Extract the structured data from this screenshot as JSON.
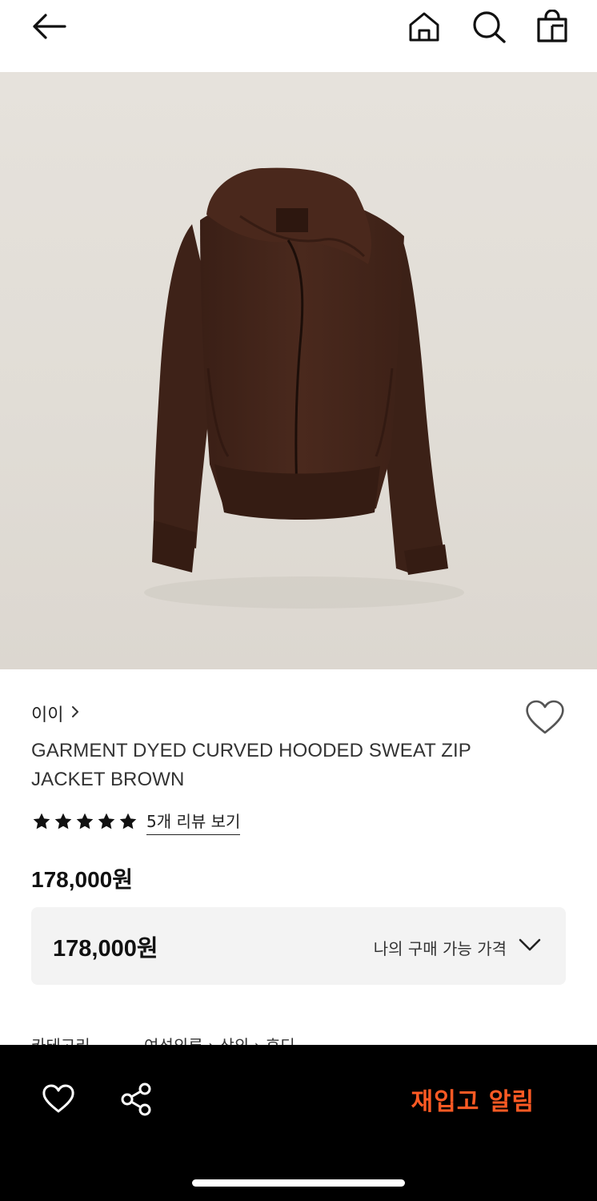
{
  "header": {
    "back_icon": "arrow-left-icon",
    "home_icon": "home-icon",
    "search_icon": "search-icon",
    "bag_icon": "shopping-bag-icon"
  },
  "product": {
    "image_alt": "brown hooded zip jacket",
    "brand": "이이",
    "title_line1": "GARMENT DYED CURVED HOODED SWEAT ZIP",
    "title_line2": "JACKET BROWN",
    "rating": 5,
    "rating_max": 5,
    "review_link": "5개 리뷰 보기",
    "price": "178,000원",
    "my_price": "178,000원",
    "my_price_label": "나의 구매 가능 가격",
    "wish_icon": "heart-outline-icon"
  },
  "category": {
    "label": "카테고리",
    "path": "여성의류 › 상의 › 후디"
  },
  "bottom_bar": {
    "wish_icon": "heart-outline-icon",
    "share_icon": "share-icon",
    "cta": "재입고 알림",
    "cta_color": "#ff5a24",
    "background": "#000000"
  }
}
